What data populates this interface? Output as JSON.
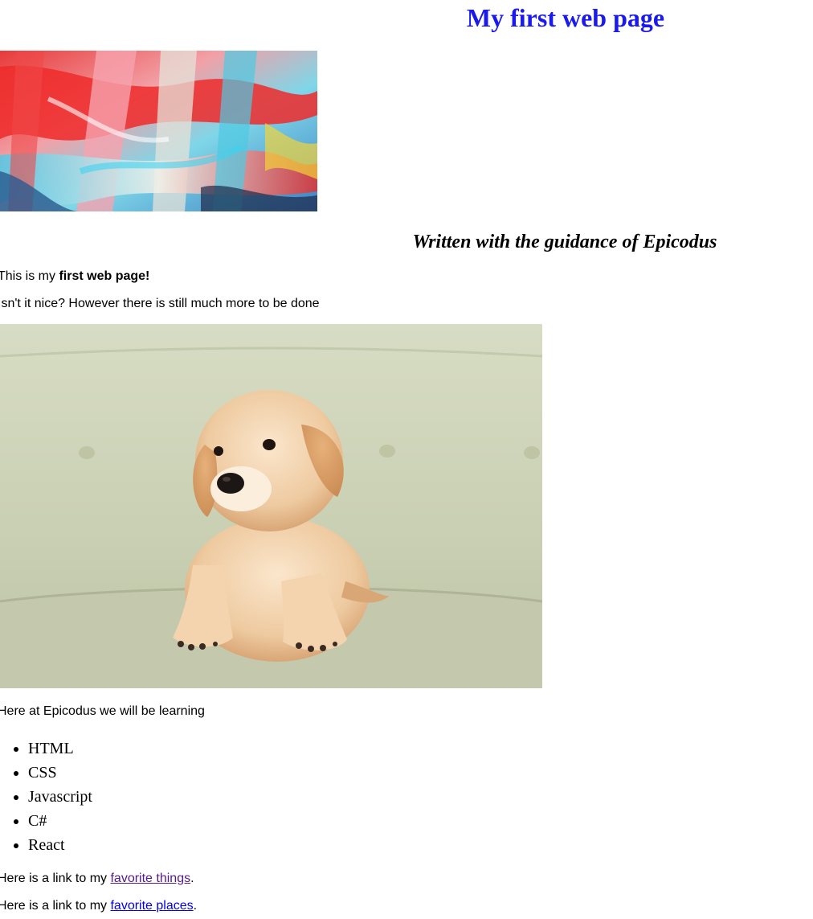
{
  "header": {
    "title": "My first web page",
    "title_color": "#1a1aee"
  },
  "images": {
    "hero": "abstract-painting",
    "puppy": "golden-retriever-puppy"
  },
  "subtitle": "Written with the guidance of Epicodus",
  "intro": {
    "prefix": "This is my ",
    "bold": "first web page!"
  },
  "line2": "Isn't it nice? However there is still much more to be done",
  "learning_intro": "Here at Epicodus we will be learning",
  "topics": [
    "HTML",
    "CSS",
    "Javascript",
    "C#",
    "React"
  ],
  "links": [
    {
      "prefix": "Here is a link to my ",
      "text": "favorite things",
      "suffix": ".",
      "visited": true
    },
    {
      "prefix": "Here is a link to my ",
      "text": "favorite places",
      "suffix": ".",
      "visited": false
    }
  ],
  "colors": {
    "link_visited": "#551a8b",
    "link_unvisited": "#0000ee"
  }
}
